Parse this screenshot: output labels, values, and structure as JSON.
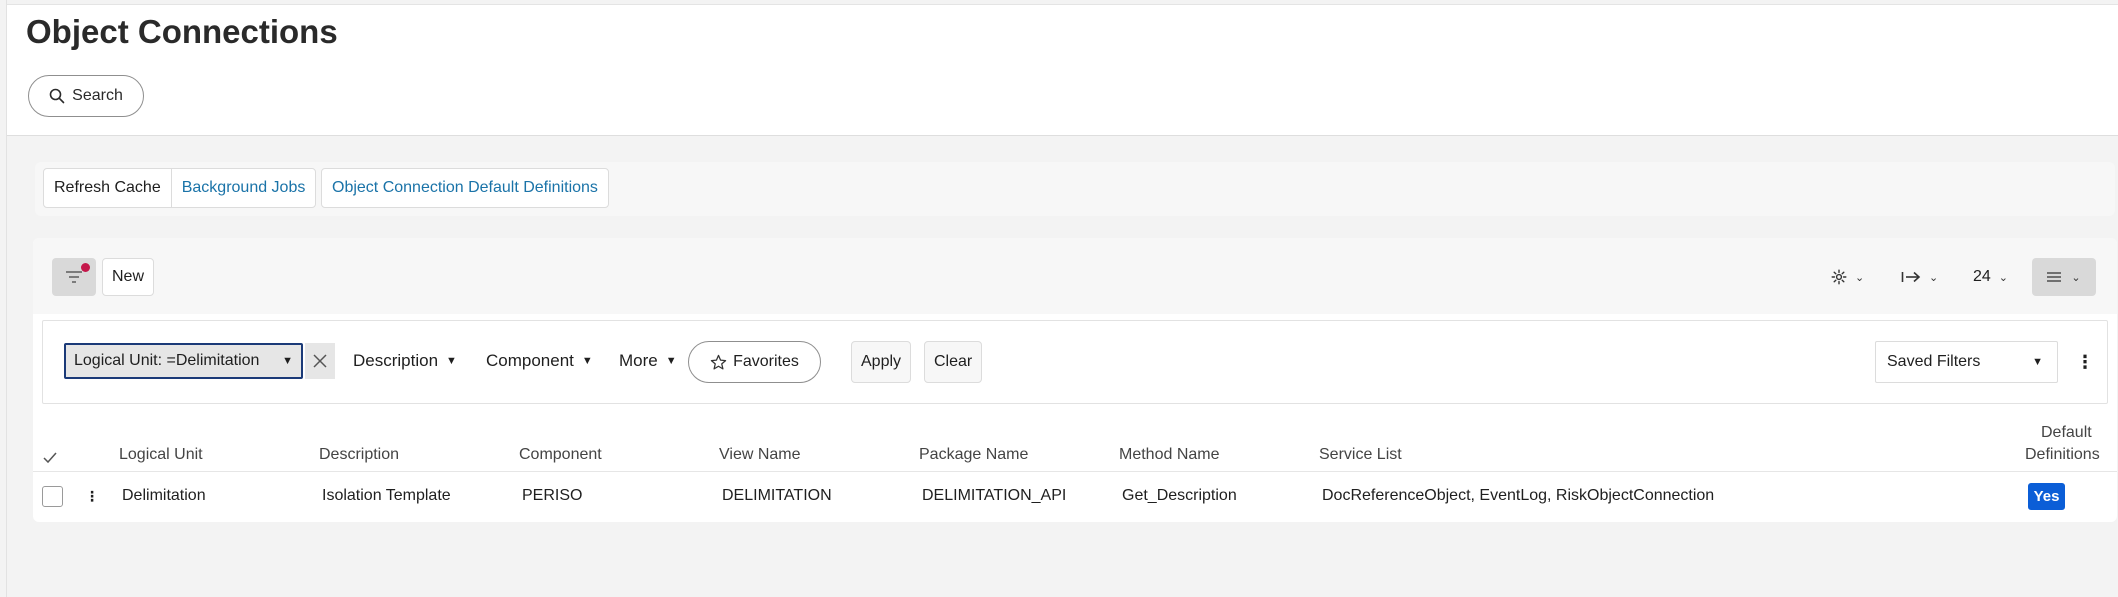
{
  "page": {
    "title": "Object Connections"
  },
  "search": {
    "label": "Search"
  },
  "commands": {
    "refresh_cache": "Refresh Cache",
    "background_jobs": "Background Jobs",
    "default_definitions": "Object Connection Default Definitions"
  },
  "toolbar": {
    "new_label": "New",
    "page_size": "24"
  },
  "filters": {
    "active_chip": "Logical Unit: =Delimitation",
    "description": "Description",
    "component": "Component",
    "more": "More",
    "favorites": "Favorites",
    "apply": "Apply",
    "clear": "Clear",
    "saved_filters": "Saved Filters"
  },
  "table": {
    "columns": [
      "Logical Unit",
      "Description",
      "Component",
      "View Name",
      "Package Name",
      "Method Name",
      "Service List",
      "Default",
      "Definitions"
    ],
    "rows": [
      {
        "logical_unit": "Delimitation",
        "description": "Isolation Template",
        "component": "PERISO",
        "view_name": "DELIMITATION",
        "package_name": "DELIMITATION_API",
        "method_name": "Get_Description",
        "service_list": "DocReferenceObject, EventLog, RiskObjectConnection",
        "default_definitions": "Yes"
      }
    ]
  },
  "colors": {
    "link": "#1a73a8",
    "badge": "#0b5ed7",
    "notification_dot": "#c4174a",
    "chip_border": "#1b3a78"
  }
}
